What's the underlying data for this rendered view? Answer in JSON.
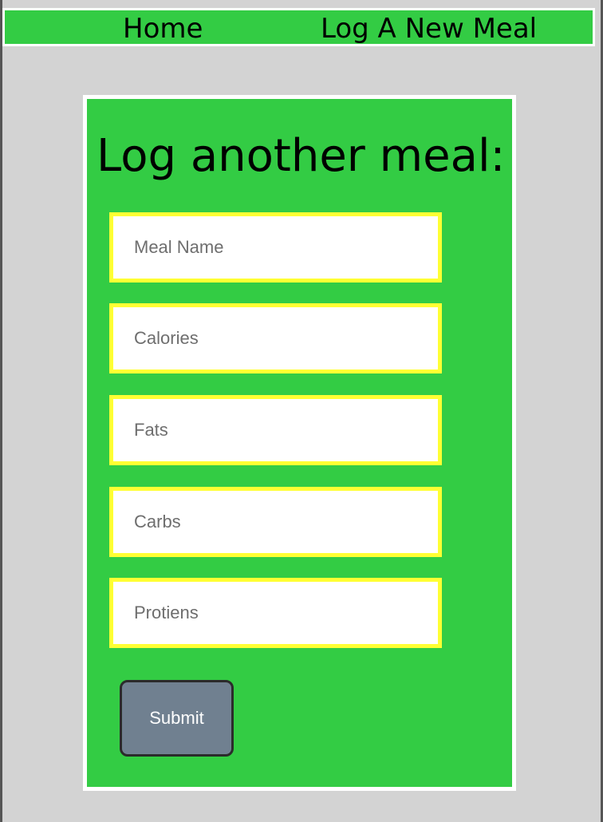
{
  "nav": {
    "home_label": "Home",
    "log_meal_label": "Log A New Meal"
  },
  "form": {
    "title": "Log another meal:",
    "fields": [
      {
        "placeholder": "Meal Name",
        "value": ""
      },
      {
        "placeholder": "Calories",
        "value": ""
      },
      {
        "placeholder": "Fats",
        "value": ""
      },
      {
        "placeholder": "Carbs",
        "value": ""
      },
      {
        "placeholder": "Protiens",
        "value": ""
      }
    ],
    "submit_label": "Submit"
  },
  "colors": {
    "accent_green": "#33cc44",
    "field_border_yellow": "#ffff33",
    "page_background": "#d3d3d3",
    "submit_button": "#708090"
  }
}
